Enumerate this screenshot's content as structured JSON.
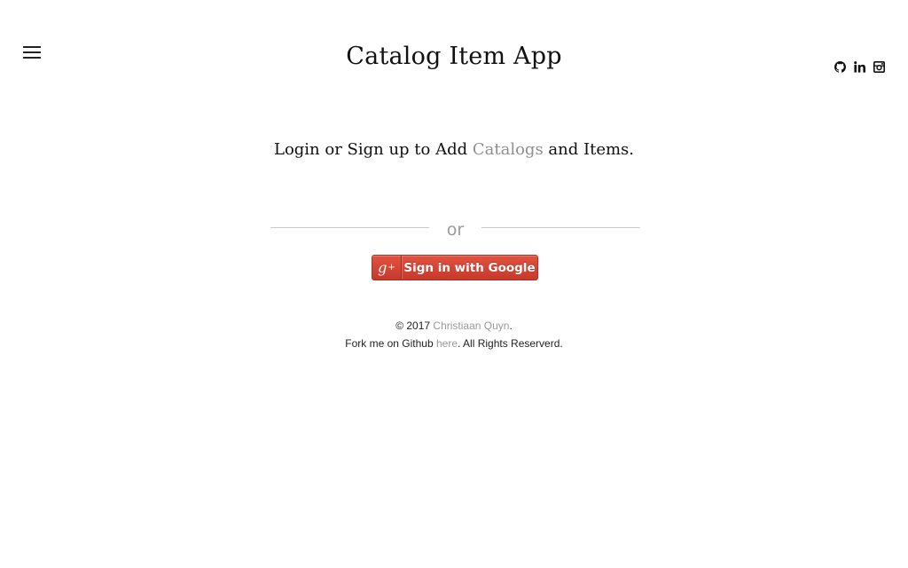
{
  "header": {
    "title": "Catalog Item App",
    "menu_icon": "hamburger-menu-icon",
    "social_icons": [
      "github-icon",
      "linkedin-icon",
      "instagram-icon"
    ]
  },
  "main": {
    "tagline_prefix": "Login or Sign up to Add ",
    "tagline_link": "Catalogs",
    "tagline_suffix": " and Items.",
    "divider_label": "or",
    "google_button": {
      "icon_text": "g",
      "icon_sup": "+",
      "label": "Sign in with Google"
    }
  },
  "footer": {
    "copyright_prefix": "© 2017 ",
    "author_link": "Christiaan Quyn",
    "copyright_suffix": ".",
    "fork_prefix": "Fork me on Github ",
    "fork_link": "here",
    "fork_suffix": ". All Rights Reserverd."
  },
  "colors": {
    "link_gray": "#8f8f8f",
    "google_red": "#d34836",
    "divider": "#cccccc"
  }
}
